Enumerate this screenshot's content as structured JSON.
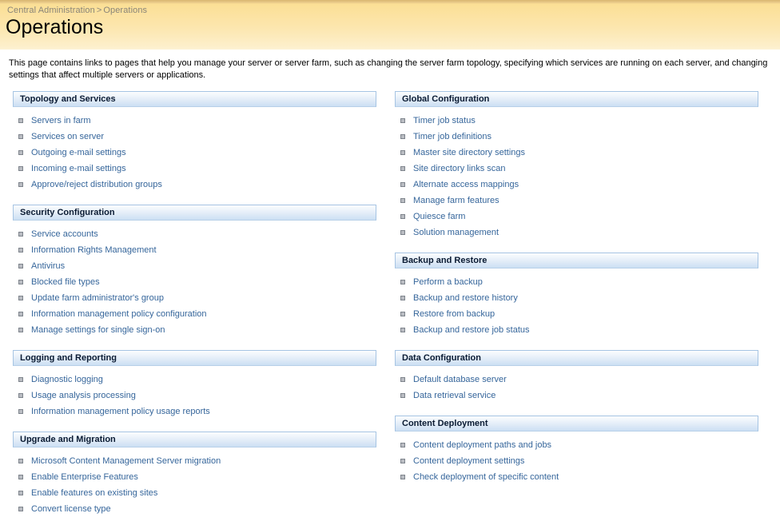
{
  "banner": {
    "breadcrumb": {
      "root_label": "Central Administration",
      "separator": ">",
      "current_label": "Operations"
    },
    "title": "Operations",
    "colors": {
      "banner_top": "#d8b670",
      "banner_mid": "#fbdf95",
      "banner_bottom": "#fdf2d4",
      "breadcrumb_text": "#8a8578",
      "title_text": "#000000"
    }
  },
  "description": "This page contains links to pages that help you manage your server or server farm, such as changing the server farm topology, specifying which services are running on each server, and changing settings that affect multiple servers or applications.",
  "theme": {
    "link_color": "#36669b",
    "section_header_border": "#a6c4e3",
    "section_header_gradient_top": "#fbfdfe",
    "section_header_gradient_bottom": "#cbdff4",
    "section_header_text": "#0a1b33",
    "bullet_fill": "#b9bcc2",
    "bullet_border": "#7e848c",
    "page_background": "#ffffff"
  },
  "bullet_icon_name": "square-bullet-icon",
  "columns": {
    "left": [
      {
        "id": "topology-and-services",
        "title": "Topology and Services",
        "links": [
          "Servers in farm",
          "Services on server",
          "Outgoing e-mail settings",
          "Incoming e-mail settings",
          "Approve/reject distribution groups"
        ]
      },
      {
        "id": "security-configuration",
        "title": "Security Configuration",
        "links": [
          "Service accounts",
          "Information Rights Management",
          "Antivirus",
          "Blocked file types",
          "Update farm administrator's group",
          "Information management policy configuration",
          "Manage settings for single sign-on"
        ]
      },
      {
        "id": "logging-and-reporting",
        "title": "Logging and Reporting",
        "links": [
          "Diagnostic logging",
          "Usage analysis processing",
          "Information management policy usage reports"
        ]
      },
      {
        "id": "upgrade-and-migration",
        "title": "Upgrade and Migration",
        "links": [
          "Microsoft Content Management Server migration",
          "Enable Enterprise Features",
          "Enable features on existing sites",
          "Convert license type"
        ]
      }
    ],
    "right": [
      {
        "id": "global-configuration",
        "title": "Global Configuration",
        "links": [
          "Timer job status",
          "Timer job definitions",
          "Master site directory settings",
          "Site directory links scan",
          "Alternate access mappings",
          "Manage farm features",
          "Quiesce farm",
          "Solution management"
        ]
      },
      {
        "id": "backup-and-restore",
        "title": "Backup and Restore",
        "links": [
          "Perform a backup",
          "Backup and restore history",
          "Restore from backup",
          "Backup and restore job status"
        ]
      },
      {
        "id": "data-configuration",
        "title": "Data Configuration",
        "links": [
          "Default database server",
          "Data retrieval service"
        ]
      },
      {
        "id": "content-deployment",
        "title": "Content Deployment",
        "links": [
          "Content deployment paths and jobs",
          "Content deployment settings",
          "Check deployment of specific content"
        ]
      }
    ]
  }
}
